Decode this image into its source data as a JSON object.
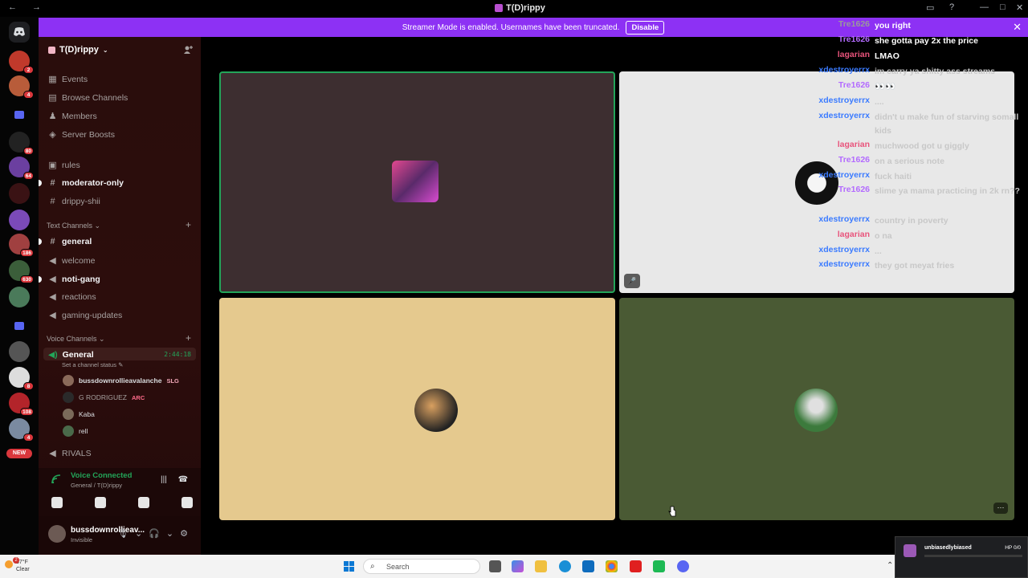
{
  "window": {
    "title": "T(D)rippy",
    "nav": "← →"
  },
  "banner": {
    "text": "Streamer Mode is enabled. Usernames have been truncated.",
    "button": "Disable",
    "close": "✕"
  },
  "rail": {
    "badges": [
      "2",
      "4",
      "80",
      "64",
      "186",
      "630",
      "8",
      "108",
      "4"
    ],
    "new_label": "NEW"
  },
  "server": {
    "name": "T(D)rippy",
    "top_items": [
      {
        "label": "Events",
        "icon": "calendar-icon"
      },
      {
        "label": "Browse Channels",
        "icon": "browse-icon"
      },
      {
        "label": "Members",
        "icon": "members-icon"
      },
      {
        "label": "Server Boosts",
        "icon": "boost-icon"
      }
    ],
    "channels_top": [
      {
        "label": "rules",
        "icon": "rules-icon",
        "bold": false
      },
      {
        "label": "moderator-only",
        "icon": "hash-icon",
        "bold": true
      },
      {
        "label": "drippy-shii",
        "icon": "hash-icon",
        "bold": false
      }
    ],
    "text_category": "Text Channels",
    "text_channels": [
      {
        "label": "general",
        "icon": "hash-icon",
        "bold": true
      },
      {
        "label": "welcome",
        "icon": "megaphone-icon",
        "bold": false
      },
      {
        "label": "noti-gang",
        "icon": "megaphone-icon",
        "bold": true
      },
      {
        "label": "reactions",
        "icon": "megaphone-icon",
        "bold": false
      },
      {
        "label": "gaming-updates",
        "icon": "megaphone-icon",
        "bold": false
      }
    ],
    "voice_category": "Voice Channels",
    "voice_channel": {
      "name": "General",
      "time": "2:44:18",
      "status": "Set a channel status"
    },
    "members": [
      {
        "name": "bussdownrollieavalanche",
        "tag": "SLG"
      },
      {
        "name": "G RODRIGUEZ",
        "tag": "ARC"
      },
      {
        "name": "Kaba",
        "tag": ""
      },
      {
        "name": "rell",
        "tag": ""
      }
    ],
    "next_voice": "RIVALS"
  },
  "voice_panel": {
    "title": "Voice Connected",
    "subtitle": "General / T(D)rippy"
  },
  "user": {
    "name": "bussdownrollieav...",
    "status": "Invisible"
  },
  "chat": [
    {
      "user": "Tre1626",
      "color": "#9a9a9a",
      "text": "you right",
      "textColor": "#ffffff"
    },
    {
      "user": "Tre1626",
      "color": "#b36bff",
      "text": "she gotta pay 2x the price",
      "textColor": "#ffffff"
    },
    {
      "user": "lagarian",
      "color": "#e8537b",
      "text": "LMAO",
      "textColor": "#ffffff"
    },
    {
      "user": "xdestroyerrx",
      "color": "#3b7bff",
      "text": "im carry ya shitty ass streams",
      "textColor": "#c8c8c8"
    },
    {
      "user": "Tre1626",
      "color": "#b36bff",
      "text": "👀👀",
      "textColor": "#c8c8c8"
    },
    {
      "user": "xdestroyerrx",
      "color": "#3b7bff",
      "text": "....",
      "textColor": "#c8c8c8"
    },
    {
      "user": "xdestroyerrx",
      "color": "#3b7bff",
      "text": "didn't u make fun of starving somall kids",
      "textColor": "#c8c8c8"
    },
    {
      "user": "lagarian",
      "color": "#e8537b",
      "text": "muchwood got u giggly",
      "textColor": "#c8c8c8"
    },
    {
      "user": "Tre1626",
      "color": "#b36bff",
      "text": "on a serious note",
      "textColor": "#c8c8c8"
    },
    {
      "user": "xdestroyerrx",
      "color": "#3b7bff",
      "text": "fuck haiti",
      "textColor": "#c8c8c8"
    },
    {
      "user": "Tre1626",
      "color": "#b36bff",
      "text": "slime ya mama practicing in 2k rn??",
      "textColor": "#c8c8c8"
    },
    {
      "user": "xdestroyerrx",
      "color": "#3b7bff",
      "text": "country in poverty",
      "textColor": "#c8c8c8"
    },
    {
      "user": "lagarian",
      "color": "#e8537b",
      "text": "o na",
      "textColor": "#c8c8c8"
    },
    {
      "user": "xdestroyerrx",
      "color": "#3b7bff",
      "text": "...",
      "textColor": "#c8c8c8"
    },
    {
      "user": "xdestroyerrx",
      "color": "#3b7bff",
      "text": "they got meyat fries",
      "textColor": "#c8c8c8"
    }
  ],
  "taskbar": {
    "weather_temp": "57°F",
    "weather_desc": "Clear",
    "weather_badge": "2",
    "search_placeholder": "Search"
  },
  "toast": {
    "name": "unbiasedlybiased",
    "hp": "HP 0/0",
    "hp_fraction": 0.0
  },
  "colors": {
    "banner": "#8d31f4",
    "speaking_border": "#23a559",
    "tile1": "#3d2e30",
    "tile2": "#e8e8e8",
    "tile3": "#e5c98e",
    "tile4": "#4a5a34"
  }
}
